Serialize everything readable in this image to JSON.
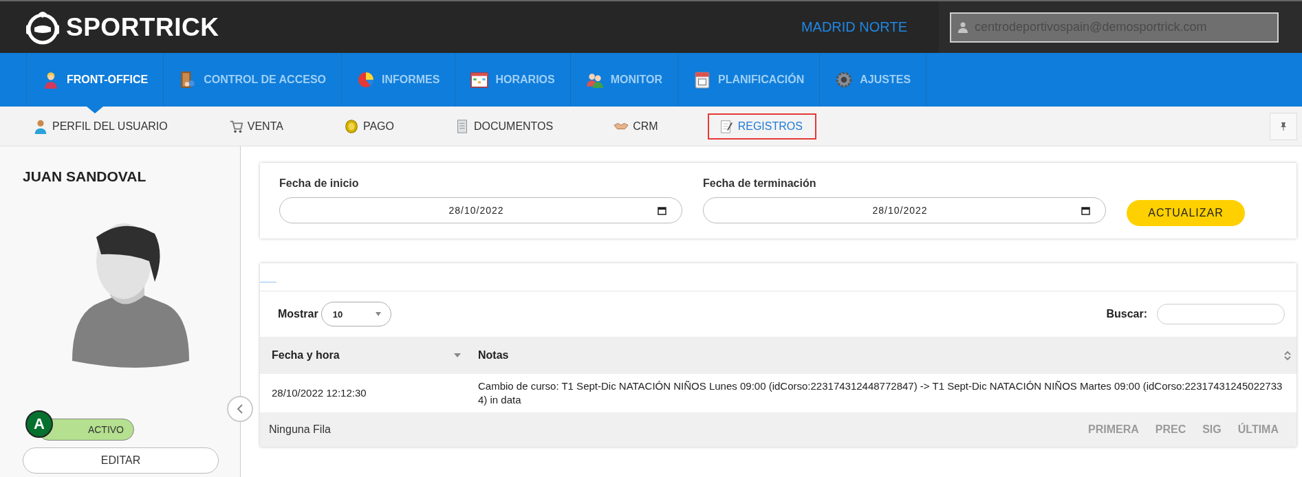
{
  "header": {
    "logo": "SPORTRICK",
    "center": "MADRID NORTE",
    "user_email": "centrodeportivospain@demosportrick.com"
  },
  "main_nav": [
    {
      "label": "FRONT-OFFICE",
      "selected": true
    },
    {
      "label": "CONTROL DE ACCESO",
      "selected": false
    },
    {
      "label": "INFORMES",
      "selected": false
    },
    {
      "label": "HORARIOS",
      "selected": false
    },
    {
      "label": "MONITOR",
      "selected": false
    },
    {
      "label": "PLANIFICACIÓN",
      "selected": false
    },
    {
      "label": "AJUSTES",
      "selected": false
    }
  ],
  "sub_nav": [
    {
      "label": "PERFIL DEL USUARIO",
      "selected": false
    },
    {
      "label": "VENTA",
      "selected": false
    },
    {
      "label": "PAGO",
      "selected": false
    },
    {
      "label": "DOCUMENTOS",
      "selected": false
    },
    {
      "label": "CRM",
      "selected": false
    },
    {
      "label": "REGISTROS",
      "selected": true
    }
  ],
  "profile": {
    "name": "JUAN SANDOVAL",
    "badge": "A",
    "status": "ACTIVO",
    "active": true,
    "edit_button": "EDITAR"
  },
  "filters": {
    "start_label": "Fecha de inicio",
    "start_value": "28/10/2022",
    "end_label": "Fecha de terminación",
    "end_value": "28/10/2022",
    "update_button": "ACTUALIZAR"
  },
  "table": {
    "show_label": "Mostrar",
    "page_size": "10",
    "search_label": "Buscar:",
    "columns": [
      {
        "label": "Fecha y hora",
        "sorted": true
      },
      {
        "label": "Notas",
        "sorted": false
      }
    ],
    "rows": [
      {
        "date": "28/10/2022 12:12:30",
        "notes": "Cambio de curso: T1 Sept-Dic NATACIÓN NIÑOS Lunes 09:00 (idCorso:223174312448772847) -> T1 Sept-Dic NATACIÓN NIÑOS Martes 09:00 (idCorso:223174312450227334) in data"
      }
    ],
    "footer": "Ninguna Fila",
    "pager": [
      {
        "label": "PRIMERA",
        "disabled": true
      },
      {
        "label": "PREC",
        "disabled": true
      },
      {
        "label": "SIG",
        "disabled": true
      },
      {
        "label": "ÚLTIMA",
        "disabled": true
      }
    ]
  }
}
